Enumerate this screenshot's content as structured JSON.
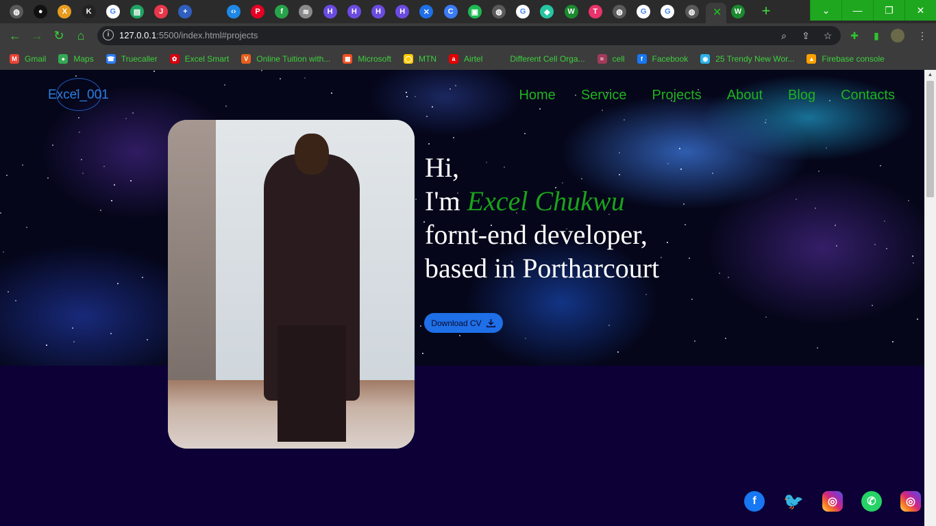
{
  "browser": {
    "tab_icons": [
      {
        "name": "globe-icon",
        "color": "#5a5a5a",
        "glyph": "◍"
      },
      {
        "name": "github-icon",
        "color": "#111111",
        "glyph": "●"
      },
      {
        "name": "x-logo-icon",
        "color": "#e89b1f",
        "glyph": "X"
      },
      {
        "name": "k-logo-icon",
        "color": "#222222",
        "glyph": "K"
      },
      {
        "name": "google-icon",
        "color": "#ffffff",
        "glyph": "G"
      },
      {
        "name": "sheet-icon",
        "color": "#1fa463",
        "glyph": "▤"
      },
      {
        "name": "j-logo-icon",
        "color": "#e8374b",
        "glyph": "J"
      },
      {
        "name": "plus-logo-icon",
        "color": "#2f5fbf",
        "glyph": "+"
      },
      {
        "name": "blank-tab-icon",
        "color": "#2b2b2b",
        "glyph": ""
      },
      {
        "name": "code-icon",
        "color": "#1e88e5",
        "glyph": "‹›"
      },
      {
        "name": "pinterest-icon",
        "color": "#e60023",
        "glyph": "P"
      },
      {
        "name": "fn-logo-icon",
        "color": "#27a34a",
        "glyph": "f"
      },
      {
        "name": "layers-icon",
        "color": "#8a8a8a",
        "glyph": "≋"
      },
      {
        "name": "h-logo-icon",
        "color": "#6b4be0",
        "glyph": "H"
      },
      {
        "name": "h-logo-icon",
        "color": "#6b4be0",
        "glyph": "H"
      },
      {
        "name": "h-logo-icon",
        "color": "#6b4be0",
        "glyph": "H"
      },
      {
        "name": "h-logo-icon",
        "color": "#6b4be0",
        "glyph": "H"
      },
      {
        "name": "x-app-icon",
        "color": "#1e6fe8",
        "glyph": "✕"
      },
      {
        "name": "c-logo-icon",
        "color": "#3b7bf5",
        "glyph": "C"
      },
      {
        "name": "green-app-icon",
        "color": "#1db954",
        "glyph": "▣"
      },
      {
        "name": "globe-icon",
        "color": "#5a5a5a",
        "glyph": "◍"
      },
      {
        "name": "google-icon",
        "color": "#ffffff",
        "glyph": "G"
      },
      {
        "name": "tag-icon",
        "color": "#26c6a2",
        "glyph": "◆"
      },
      {
        "name": "w-logo-icon",
        "color": "#1b8a2f",
        "glyph": "W"
      },
      {
        "name": "t-logo-icon",
        "color": "#e8336b",
        "glyph": "T"
      },
      {
        "name": "globe-icon",
        "color": "#5a5a5a",
        "glyph": "◍"
      },
      {
        "name": "google-icon",
        "color": "#ffffff",
        "glyph": "G"
      },
      {
        "name": "google-icon",
        "color": "#ffffff",
        "glyph": "G"
      },
      {
        "name": "globe-icon",
        "color": "#5a5a5a",
        "glyph": "◍"
      }
    ],
    "active_tab_icon": {
      "name": "w-logo-icon",
      "color": "#1b8a2f",
      "glyph": "W"
    },
    "url_host": "127.0.0.1",
    "url_rest": ":5500/index.html#projects",
    "bookmarks": [
      {
        "label": "Gmail",
        "icon": "gmail-icon",
        "color": "#ea4335",
        "glyph": "M"
      },
      {
        "label": "Maps",
        "icon": "maps-pin-icon",
        "color": "#34a853",
        "glyph": "●"
      },
      {
        "label": "Truecaller",
        "icon": "truecaller-icon",
        "color": "#2d7df6",
        "glyph": "☎"
      },
      {
        "label": "Excel Smart",
        "icon": "huawei-icon",
        "color": "#d7000f",
        "glyph": "✿"
      },
      {
        "label": "Online Tuition with...",
        "icon": "v-logo-icon",
        "color": "#e8601c",
        "glyph": "V"
      },
      {
        "label": "Microsoft",
        "icon": "microsoft-icon",
        "color": "#f25022",
        "glyph": "▦"
      },
      {
        "label": "MTN",
        "icon": "mtn-icon",
        "color": "#ffcb05",
        "glyph": "◯"
      },
      {
        "label": "Airtel",
        "icon": "airtel-icon",
        "color": "#e40000",
        "glyph": "a"
      },
      {
        "label": "Different Cell Orga...",
        "icon": "blank-icon",
        "color": "#3c3c3c",
        "glyph": ""
      },
      {
        "label": "cell",
        "icon": "cell-icon",
        "color": "#a33a5a",
        "glyph": "≈"
      },
      {
        "label": "Facebook",
        "icon": "facebook-icon",
        "color": "#1877f2",
        "glyph": "f"
      },
      {
        "label": "25 Trendy New Wor...",
        "icon": "eye-icon",
        "color": "#2ab3e8",
        "glyph": "◉"
      },
      {
        "label": "Firebase console",
        "icon": "firebase-icon",
        "color": "#ffa000",
        "glyph": "▲"
      }
    ]
  },
  "site": {
    "logo": "Excel_001",
    "nav": [
      "Home",
      "Service",
      "Projects",
      "About",
      "Blog",
      "Contacts"
    ],
    "intro": {
      "line1": "Hi,",
      "im": "I'm ",
      "name": "Excel Chukwu",
      "line3": "fornt-end developer,",
      "line4": "based in Portharcourt"
    },
    "cv_button": "Download CV",
    "socials": [
      "facebook-icon",
      "twitter-icon",
      "instagram-icon",
      "whatsapp-icon",
      "instagram-icon"
    ]
  }
}
